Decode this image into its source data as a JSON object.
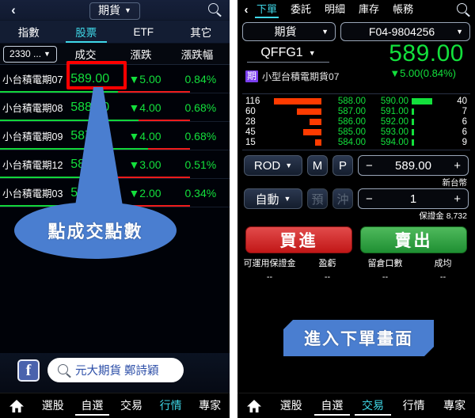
{
  "left_panel": {
    "topbar": {
      "back_icon": "chevron-left-icon",
      "title": "期貨",
      "caret": "▼",
      "search_icon": "search-icon"
    },
    "tabs": [
      {
        "label": "指數",
        "active": false
      },
      {
        "label": "股票",
        "active": true
      },
      {
        "label": "ETF",
        "active": false
      },
      {
        "label": "其它",
        "active": false
      }
    ],
    "column_header": {
      "symbol_filter": "2330 ...",
      "caret": "▼",
      "columns": [
        "成交",
        "漲跌",
        "漲跌幅"
      ]
    },
    "quotes": [
      {
        "name": "小台積電期07",
        "price": "589.00",
        "change": "▼5.00",
        "percent": "0.84%",
        "green_pct": 62
      },
      {
        "name": "小台積電期08",
        "price": "588.00",
        "change": "▼4.00",
        "percent": "0.68%",
        "green_pct": 73
      },
      {
        "name": "小台積電期09",
        "price": "587.00",
        "change": "▼4.00",
        "percent": "0.68%",
        "green_pct": 78
      },
      {
        "name": "小台積電期12",
        "price": "584.00",
        "change": "▼3.00",
        "percent": "0.51%",
        "green_pct": 52
      },
      {
        "name": "小台積電期03",
        "price": "581.00",
        "change": "▼2.00",
        "percent": "0.34%",
        "green_pct": 68
      }
    ],
    "annotation_bubble": "點成交點數",
    "banner": {
      "facebook_label": "f",
      "search_icon": "search-icon",
      "search_text": "元大期貨 鄭詩穎"
    },
    "bottom_nav": {
      "home_icon": "home-icon",
      "items": [
        {
          "label": "選股",
          "active": false,
          "underline": false
        },
        {
          "label": "自選",
          "active": false,
          "underline": true
        },
        {
          "label": "交易",
          "active": false,
          "underline": false
        },
        {
          "label": "行情",
          "active": true,
          "underline": false
        },
        {
          "label": "專家",
          "active": false,
          "underline": false
        }
      ]
    }
  },
  "right_panel": {
    "topbar": {
      "back_icon": "chevron-left-icon",
      "search_icon": "search-icon",
      "tabs": [
        {
          "label": "下單",
          "active": true
        },
        {
          "label": "委託",
          "active": false
        },
        {
          "label": "明細",
          "active": false
        },
        {
          "label": "庫存",
          "active": false
        },
        {
          "label": "帳務",
          "active": false
        }
      ]
    },
    "selectors": {
      "product": "期貨",
      "account": "F04-9804256",
      "caret": "▼"
    },
    "quote": {
      "symbol": "QFFG1",
      "caret": "▼",
      "price": "589.00",
      "change": "▼5.00(0.84%)",
      "badge": "期",
      "name": "小型台積電期貨07"
    },
    "order_book": {
      "rows": [
        {
          "bid_qty": "116",
          "bid_px": "588.00",
          "ask_px": "590.00",
          "ask_qty": "40",
          "bid_bar": 60,
          "ask_bar": 26
        },
        {
          "bid_qty": "60",
          "bid_px": "587.00",
          "ask_px": "591.00",
          "ask_qty": "7",
          "bid_bar": 31,
          "ask_bar": 3
        },
        {
          "bid_qty": "28",
          "bid_px": "586.00",
          "ask_px": "592.00",
          "ask_qty": "6",
          "bid_bar": 15,
          "ask_bar": 3
        },
        {
          "bid_qty": "45",
          "bid_px": "585.00",
          "ask_px": "593.00",
          "ask_qty": "6",
          "bid_bar": 23,
          "ask_bar": 3
        },
        {
          "bid_qty": "15",
          "bid_px": "584.00",
          "ask_px": "594.00",
          "ask_qty": "9",
          "bid_bar": 8,
          "ask_bar": 3
        }
      ]
    },
    "controls": {
      "order_type": "ROD",
      "caret": "▼",
      "market_btn": "M",
      "price_btn": "P",
      "price_minus": "−",
      "price_value": "589.00",
      "price_plus": "+",
      "currency_note": "新台幣",
      "auto_type": "自動",
      "pre_btn": "預",
      "offset_btn": "沖",
      "qty_minus": "−",
      "qty_value": "1",
      "qty_plus": "+",
      "margin_note": "保證金 8,732"
    },
    "actions": {
      "buy": "買進",
      "sell": "賣出"
    },
    "info": [
      {
        "key": "可運用保證金",
        "value": "--"
      },
      {
        "key": "盈虧",
        "value": "--"
      },
      {
        "key": "留倉口數",
        "value": "--"
      },
      {
        "key": "成均",
        "value": "--"
      }
    ],
    "annotation_banner": "進入下單畫面",
    "bottom_nav": {
      "home_icon": "home-icon",
      "items": [
        {
          "label": "選股",
          "active": false,
          "underline": false
        },
        {
          "label": "自選",
          "active": false,
          "underline": true
        },
        {
          "label": "交易",
          "active": true,
          "underline": true
        },
        {
          "label": "行情",
          "active": false,
          "underline": false
        },
        {
          "label": "專家",
          "active": false,
          "underline": false
        }
      ]
    }
  },
  "colors": {
    "up_red": "#ef1b1b",
    "down_green": "#13e03c",
    "accent_cyan": "#3fd8e8",
    "annotation_blue": "#4a7ed0",
    "highlight_red": "#ff0000",
    "badge_purple": "#7b3ff0"
  }
}
